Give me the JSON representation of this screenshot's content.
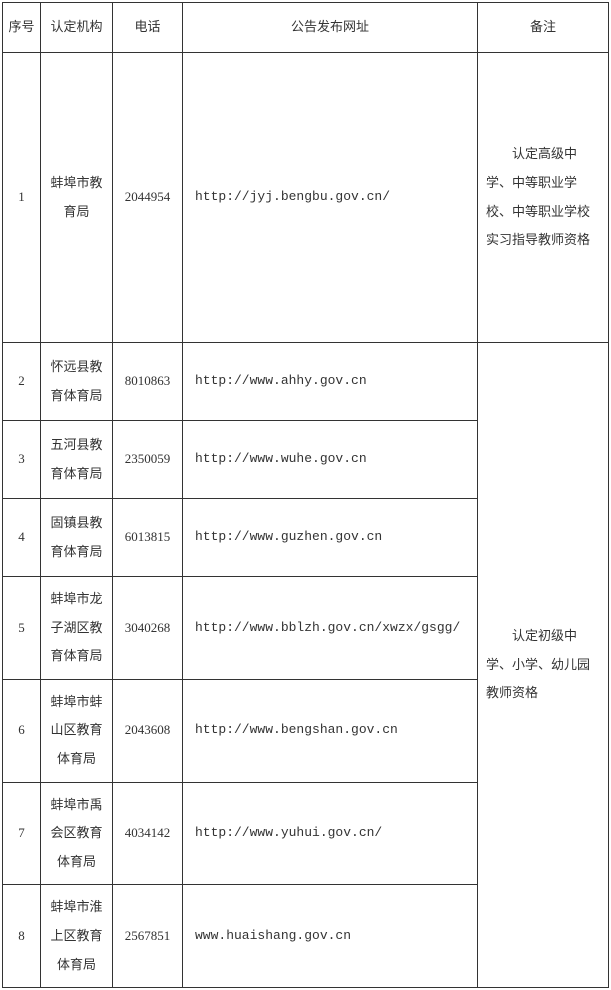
{
  "headers": {
    "num": "序号",
    "org": "认定机构",
    "phone": "电话",
    "url": "公告发布网址",
    "remarks": "备注"
  },
  "rows": [
    {
      "num": "1",
      "org": "蚌埠市教育局",
      "phone": "2044954",
      "url": "http://jyj.bengbu.gov.cn/",
      "remarks": "认定高级中学、中等职业学校、中等职业学校实习指导教师资格"
    },
    {
      "num": "2",
      "org": "怀远县教育体育局",
      "phone": "8010863",
      "url": "http://www.ahhy.gov.cn"
    },
    {
      "num": "3",
      "org": "五河县教育体育局",
      "phone": "2350059",
      "url": "http://www.wuhe.gov.cn"
    },
    {
      "num": "4",
      "org": "固镇县教育体育局",
      "phone": "6013815",
      "url": "http://www.guzhen.gov.cn"
    },
    {
      "num": "5",
      "org": "蚌埠市龙子湖区教育体育局",
      "phone": "3040268",
      "url": "http://www.bblzh.gov.cn/xwzx/gsgg/"
    },
    {
      "num": "6",
      "org": "蚌埠市蚌山区教育体育局",
      "phone": "2043608",
      "url": "http://www.bengshan.gov.cn"
    },
    {
      "num": "7",
      "org": "蚌埠市禹会区教育体育局",
      "phone": "4034142",
      "url": "http://www.yuhui.gov.cn/"
    },
    {
      "num": "8",
      "org": "蚌埠市淮上区教育体育局",
      "phone": "2567851",
      "url": "www.huaishang.gov.cn"
    }
  ],
  "remarks_group": "认定初级中学、小学、幼儿园教师资格"
}
